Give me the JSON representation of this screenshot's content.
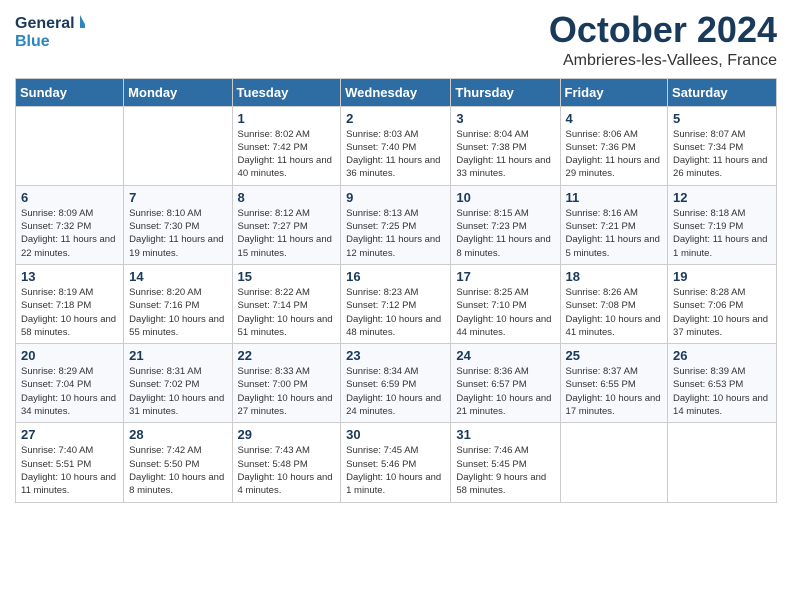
{
  "header": {
    "logo_line1": "General",
    "logo_line2": "Blue",
    "month": "October 2024",
    "location": "Ambrieres-les-Vallees, France"
  },
  "days_of_week": [
    "Sunday",
    "Monday",
    "Tuesday",
    "Wednesday",
    "Thursday",
    "Friday",
    "Saturday"
  ],
  "weeks": [
    [
      {
        "day": "",
        "info": ""
      },
      {
        "day": "",
        "info": ""
      },
      {
        "day": "1",
        "info": "Sunrise: 8:02 AM\nSunset: 7:42 PM\nDaylight: 11 hours and 40 minutes."
      },
      {
        "day": "2",
        "info": "Sunrise: 8:03 AM\nSunset: 7:40 PM\nDaylight: 11 hours and 36 minutes."
      },
      {
        "day": "3",
        "info": "Sunrise: 8:04 AM\nSunset: 7:38 PM\nDaylight: 11 hours and 33 minutes."
      },
      {
        "day": "4",
        "info": "Sunrise: 8:06 AM\nSunset: 7:36 PM\nDaylight: 11 hours and 29 minutes."
      },
      {
        "day": "5",
        "info": "Sunrise: 8:07 AM\nSunset: 7:34 PM\nDaylight: 11 hours and 26 minutes."
      }
    ],
    [
      {
        "day": "6",
        "info": "Sunrise: 8:09 AM\nSunset: 7:32 PM\nDaylight: 11 hours and 22 minutes."
      },
      {
        "day": "7",
        "info": "Sunrise: 8:10 AM\nSunset: 7:30 PM\nDaylight: 11 hours and 19 minutes."
      },
      {
        "day": "8",
        "info": "Sunrise: 8:12 AM\nSunset: 7:27 PM\nDaylight: 11 hours and 15 minutes."
      },
      {
        "day": "9",
        "info": "Sunrise: 8:13 AM\nSunset: 7:25 PM\nDaylight: 11 hours and 12 minutes."
      },
      {
        "day": "10",
        "info": "Sunrise: 8:15 AM\nSunset: 7:23 PM\nDaylight: 11 hours and 8 minutes."
      },
      {
        "day": "11",
        "info": "Sunrise: 8:16 AM\nSunset: 7:21 PM\nDaylight: 11 hours and 5 minutes."
      },
      {
        "day": "12",
        "info": "Sunrise: 8:18 AM\nSunset: 7:19 PM\nDaylight: 11 hours and 1 minute."
      }
    ],
    [
      {
        "day": "13",
        "info": "Sunrise: 8:19 AM\nSunset: 7:18 PM\nDaylight: 10 hours and 58 minutes."
      },
      {
        "day": "14",
        "info": "Sunrise: 8:20 AM\nSunset: 7:16 PM\nDaylight: 10 hours and 55 minutes."
      },
      {
        "day": "15",
        "info": "Sunrise: 8:22 AM\nSunset: 7:14 PM\nDaylight: 10 hours and 51 minutes."
      },
      {
        "day": "16",
        "info": "Sunrise: 8:23 AM\nSunset: 7:12 PM\nDaylight: 10 hours and 48 minutes."
      },
      {
        "day": "17",
        "info": "Sunrise: 8:25 AM\nSunset: 7:10 PM\nDaylight: 10 hours and 44 minutes."
      },
      {
        "day": "18",
        "info": "Sunrise: 8:26 AM\nSunset: 7:08 PM\nDaylight: 10 hours and 41 minutes."
      },
      {
        "day": "19",
        "info": "Sunrise: 8:28 AM\nSunset: 7:06 PM\nDaylight: 10 hours and 37 minutes."
      }
    ],
    [
      {
        "day": "20",
        "info": "Sunrise: 8:29 AM\nSunset: 7:04 PM\nDaylight: 10 hours and 34 minutes."
      },
      {
        "day": "21",
        "info": "Sunrise: 8:31 AM\nSunset: 7:02 PM\nDaylight: 10 hours and 31 minutes."
      },
      {
        "day": "22",
        "info": "Sunrise: 8:33 AM\nSunset: 7:00 PM\nDaylight: 10 hours and 27 minutes."
      },
      {
        "day": "23",
        "info": "Sunrise: 8:34 AM\nSunset: 6:59 PM\nDaylight: 10 hours and 24 minutes."
      },
      {
        "day": "24",
        "info": "Sunrise: 8:36 AM\nSunset: 6:57 PM\nDaylight: 10 hours and 21 minutes."
      },
      {
        "day": "25",
        "info": "Sunrise: 8:37 AM\nSunset: 6:55 PM\nDaylight: 10 hours and 17 minutes."
      },
      {
        "day": "26",
        "info": "Sunrise: 8:39 AM\nSunset: 6:53 PM\nDaylight: 10 hours and 14 minutes."
      }
    ],
    [
      {
        "day": "27",
        "info": "Sunrise: 7:40 AM\nSunset: 5:51 PM\nDaylight: 10 hours and 11 minutes."
      },
      {
        "day": "28",
        "info": "Sunrise: 7:42 AM\nSunset: 5:50 PM\nDaylight: 10 hours and 8 minutes."
      },
      {
        "day": "29",
        "info": "Sunrise: 7:43 AM\nSunset: 5:48 PM\nDaylight: 10 hours and 4 minutes."
      },
      {
        "day": "30",
        "info": "Sunrise: 7:45 AM\nSunset: 5:46 PM\nDaylight: 10 hours and 1 minute."
      },
      {
        "day": "31",
        "info": "Sunrise: 7:46 AM\nSunset: 5:45 PM\nDaylight: 9 hours and 58 minutes."
      },
      {
        "day": "",
        "info": ""
      },
      {
        "day": "",
        "info": ""
      }
    ]
  ]
}
